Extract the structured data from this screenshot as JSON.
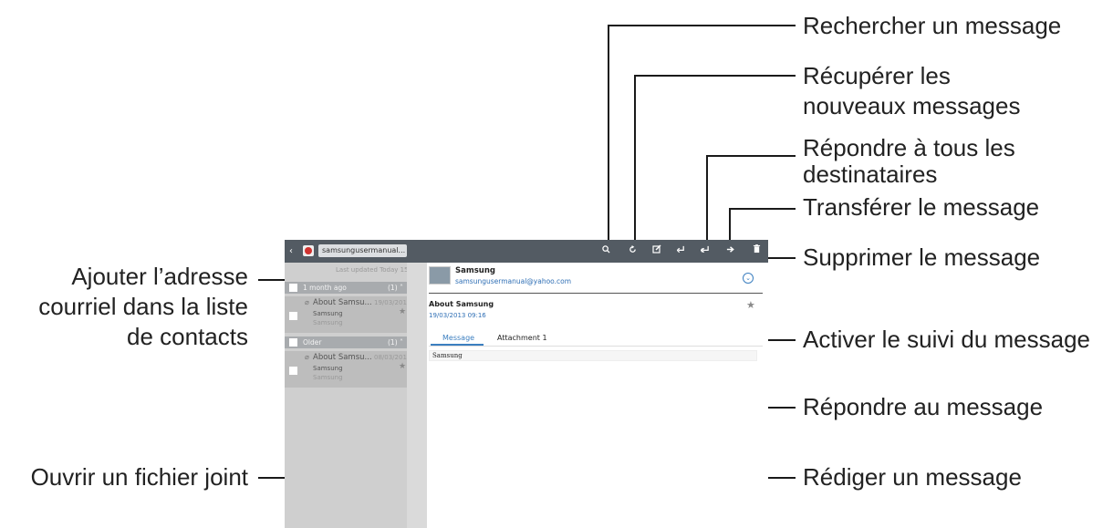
{
  "labels": {
    "search": "Rechercher un message",
    "refresh_line1": "Récupérer les",
    "refresh_line2": "nouveaux messages",
    "reply_all_line1": "Répondre à tous les",
    "reply_all_line2": "destinataires",
    "forward": "Transférer le message",
    "delete": "Supprimer le message",
    "add_contact_line1": "Ajouter l’adresse",
    "add_contact_line2": "courriel dans la liste",
    "add_contact_line3": "de contacts",
    "flag": "Activer le suivi du message",
    "reply": "Répondre au message",
    "attachment": "Ouvrir un fichier joint",
    "compose": "Rédiger un message"
  },
  "screen": {
    "account": "samsungusermanual...",
    "last_updated": "Last updated  Today 15:38",
    "groups": [
      {
        "title": "1 month ago",
        "count": "(1)"
      },
      {
        "title": "Older",
        "count": "(1)"
      }
    ],
    "messages": [
      {
        "subject": "About Samsu...",
        "date": "19/03/2013",
        "sender": "Samsung",
        "preview": "Samsung"
      },
      {
        "subject": "About Samsu...",
        "date": "08/03/2013",
        "sender": "Samsung",
        "preview": "Samsung"
      }
    ],
    "reader": {
      "sender_name": "Samsung",
      "sender_email": "samsungusermanual@yahoo.com",
      "subject": "About Samsung",
      "datetime": "19/03/2013  09:16",
      "tabs": [
        "Message",
        "Attachment 1"
      ],
      "body": "Samsung"
    }
  },
  "colors": {
    "action_bar": "#535b63",
    "list_bg": "#cfcfcf",
    "link": "#2f6fb5",
    "accent_tab": "#3c7fc0"
  }
}
